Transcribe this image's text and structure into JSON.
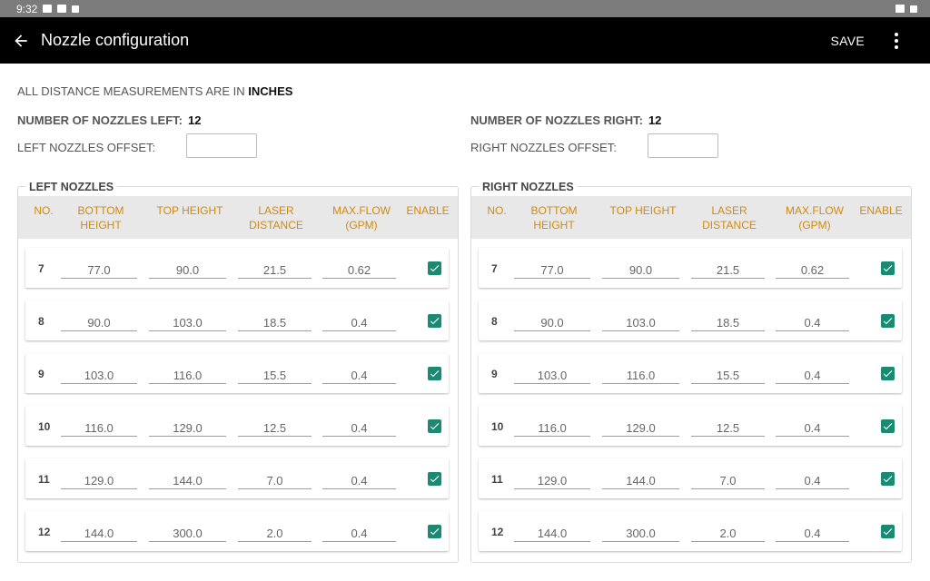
{
  "status_bar": {
    "time": "9:32"
  },
  "app_bar": {
    "title": "Nozzle configuration",
    "save_label": "SAVE"
  },
  "units": {
    "prefix": "ALL DISTANCE MEASUREMENTS ARE IN",
    "unit": "INCHES"
  },
  "left": {
    "count_label": "NUMBER OF NOZZLES LEFT:",
    "count": "12",
    "offset_label": "LEFT NOZZLES OFFSET:",
    "offset_value": "",
    "panel_title": "LEFT NOZZLES"
  },
  "right": {
    "count_label": "NUMBER OF NOZZLES RIGHT:",
    "count": "12",
    "offset_label": "RIGHT NOZZLES OFFSET:",
    "offset_value": "",
    "panel_title": "RIGHT NOZZLES"
  },
  "columns": {
    "no": "NO.",
    "bottom_1": "BOTTOM",
    "bottom_2": "HEIGHT",
    "top": "TOP HEIGHT",
    "laser_1": "LASER",
    "laser_2": "DISTANCE",
    "flow_1": "MAX.FLOW",
    "flow_2": "(GPM)",
    "enable": "ENABLE"
  },
  "nozzles": [
    {
      "no": "7",
      "bottom": "77.0",
      "top": "90.0",
      "laser": "21.5",
      "flow": "0.62",
      "enabled": true
    },
    {
      "no": "8",
      "bottom": "90.0",
      "top": "103.0",
      "laser": "18.5",
      "flow": "0.4",
      "enabled": true
    },
    {
      "no": "9",
      "bottom": "103.0",
      "top": "116.0",
      "laser": "15.5",
      "flow": "0.4",
      "enabled": true
    },
    {
      "no": "10",
      "bottom": "116.0",
      "top": "129.0",
      "laser": "12.5",
      "flow": "0.4",
      "enabled": true
    },
    {
      "no": "11",
      "bottom": "129.0",
      "top": "144.0",
      "laser": "7.0",
      "flow": "0.4",
      "enabled": true
    },
    {
      "no": "12",
      "bottom": "144.0",
      "top": "300.0",
      "laser": "2.0",
      "flow": "0.4",
      "enabled": true
    }
  ],
  "colors": {
    "accent": "#d18a10",
    "checkbox": "#1a8a73",
    "app_bar": "#000000",
    "status_bar": "#7b7b7b"
  }
}
